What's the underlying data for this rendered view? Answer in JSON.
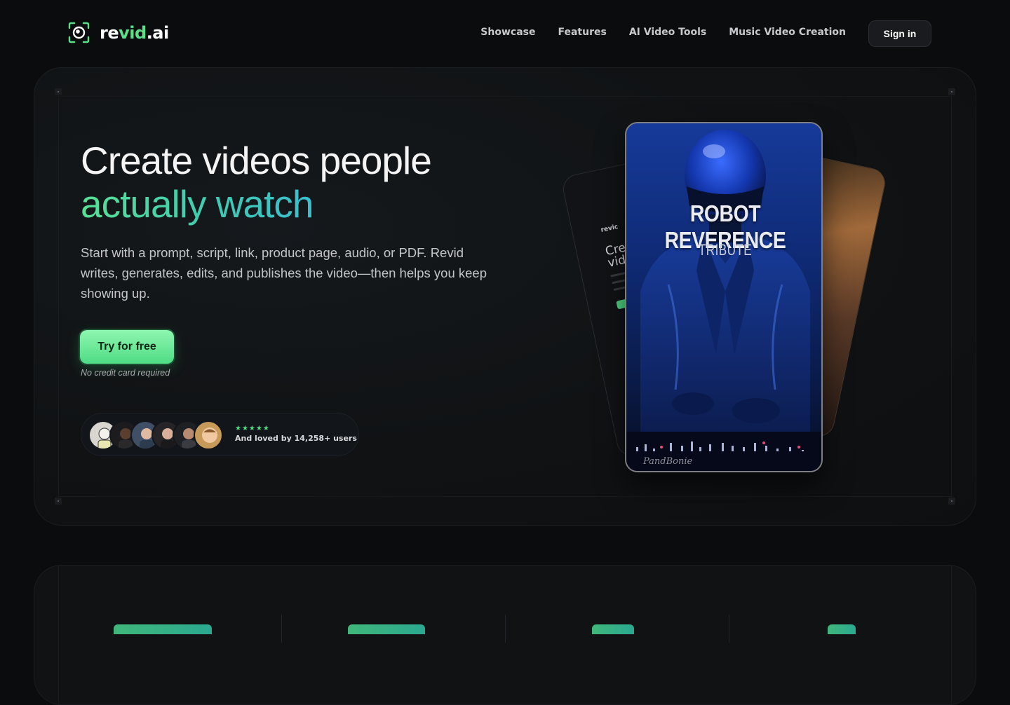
{
  "brand": {
    "name_prefix": "re",
    "name_accent": "vid",
    "name_suffix": ".ai",
    "icon": "camera-lens-logo-icon",
    "accent_color": "#5be08a"
  },
  "nav": {
    "links": [
      "Showcase",
      "Features",
      "AI Video Tools",
      "Music Video Creation"
    ],
    "signin_label": "Sign in"
  },
  "hero": {
    "headline_line1": "Create videos people",
    "headline_line2": "actually watch",
    "subtext": "Start with a prompt, script, link, product page, audio, or PDF. Revid writes, generates, edits, and publishes the video—then helps you keep showing up.",
    "cta_label": "Try for free",
    "cta_note": "No credit card required",
    "social_proof": {
      "stars": "★★★★★",
      "text": "And loved by 14,258+ users",
      "rating": 5
    }
  },
  "showcase": {
    "front_card": {
      "title": "ROBOT REVERENCE",
      "subtitle": "TRIBUTE",
      "brand": "PandBonie"
    },
    "back_card": {
      "logo": "revic",
      "heading_line1": "Cre",
      "heading_line2": "vid"
    }
  },
  "colors": {
    "background": "#0b0c0e",
    "cta_gradient_start": "#8ef6b0",
    "cta_gradient_end": "#4fdc84",
    "headline_gradient_start": "#58e095",
    "headline_gradient_end": "#3bbfd0"
  }
}
